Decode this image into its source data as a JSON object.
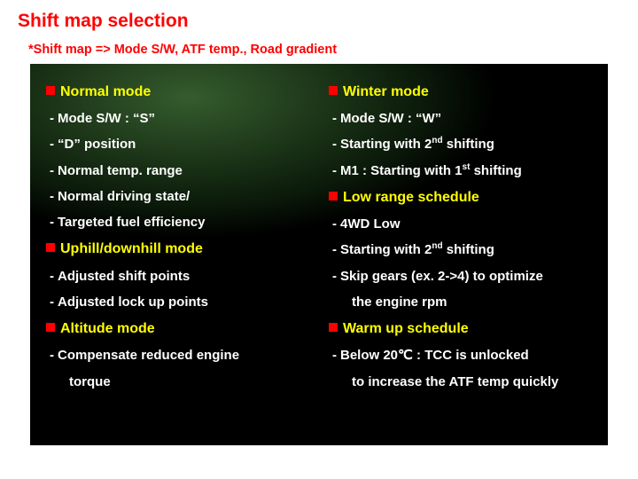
{
  "title": "Shift map selection",
  "subtitle": "*Shift map => Mode S/W, ATF temp., Road gradient",
  "left": {
    "mode1": "Normal mode",
    "m1_i1": "Mode S/W : “S”",
    "m1_i2": "“D” position",
    "m1_i3": "Normal temp. range",
    "m1_i4": "Normal driving state/",
    "m1_i5": "Targeted fuel efficiency",
    "mode2": "Uphill/downhill mode",
    "m2_i1": "Adjusted shift points",
    "m2_i2": "Adjusted lock up points",
    "mode3": "Altitude mode",
    "m3_i1": "Compensate reduced engine",
    "m3_i1b": "torque"
  },
  "right": {
    "mode1": "Winter mode",
    "m1_i1": "Mode S/W : “W”",
    "m1_i2a": "Starting with 2",
    "m1_i2sup": "nd",
    "m1_i2b": " shifting",
    "m1_i3a": "M1 : Starting with 1",
    "m1_i3sup": "st",
    "m1_i3b": " shifting",
    "mode2": "Low range schedule",
    "m2_i1": "4WD Low",
    "m2_i2a": "Starting with 2",
    "m2_i2sup": "nd",
    "m2_i2b": " shifting",
    "m2_i3": "Skip gears (ex. 2->4) to optimize",
    "m2_i3b": "the engine rpm",
    "mode3": "Warm up schedule",
    "m3_i1": "Below 20℃ : TCC is unlocked",
    "m3_i1b": "to increase the ATF temp quickly"
  }
}
